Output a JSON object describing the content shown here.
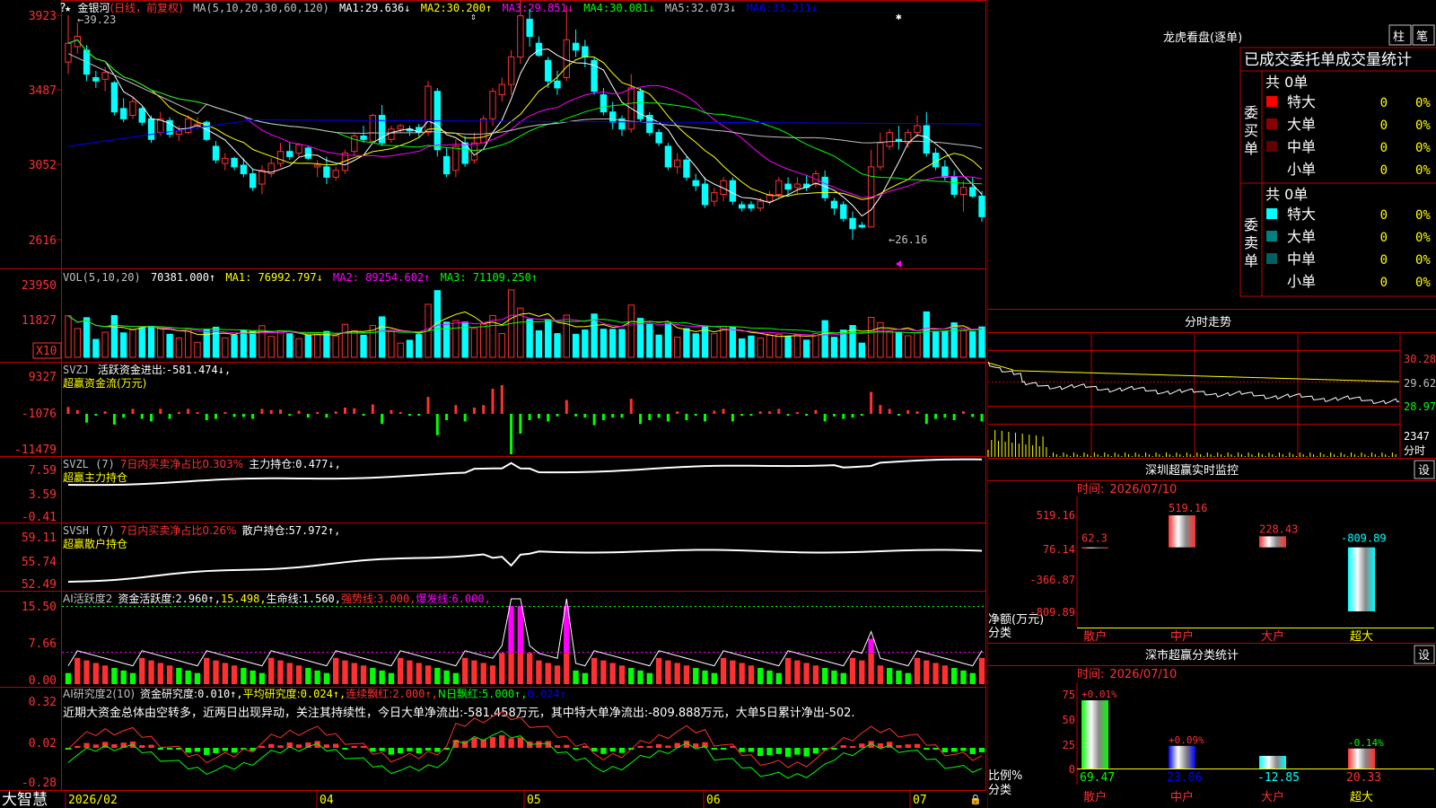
{
  "app": {
    "name": "大智慧"
  },
  "colors": {
    "up": "#ff3030",
    "down": "#00ffff",
    "frame": "#c00000",
    "bg": "#000000",
    "text": "#c0c0c0",
    "yellow": "#ffff00",
    "magenta": "#ff00ff",
    "green": "#00ff00"
  },
  "main": {
    "title": "金银河",
    "mode": "(日线，前复权)",
    "ma_label": "MA(5,10,20,30,60,120)",
    "ma_values": [
      {
        "label": "MA1:",
        "value": "29.636↓",
        "color": "#ffffff"
      },
      {
        "label": "MA2:",
        "value": "30.200↑",
        "color": "#ffff00"
      },
      {
        "label": "MA3:",
        "value": "29.851↓",
        "color": "#ff00ff"
      },
      {
        "label": "MA4:",
        "value": "30.081↓",
        "color": "#00ff00"
      },
      {
        "label": "MA5:",
        "value": "32.073↓",
        "color": "#c0c0c0"
      },
      {
        "label": "MA6:",
        "value": "33.211↓",
        "color": "#0000ff"
      }
    ],
    "high_label": "39.23",
    "low_label": "26.16",
    "y_ticks": [
      "3923",
      "3487",
      "3052",
      "2616"
    ]
  },
  "chart_data": [
    {
      "type": "candlestick",
      "title": "金银河(日线，前复权)",
      "x_ticks": [
        "2026/02",
        "04",
        "05",
        "06",
        "07"
      ],
      "y_ticks": [
        39.23,
        34.87,
        30.52,
        26.16
      ],
      "series_names": [
        "MA1",
        "MA2",
        "MA3",
        "MA4",
        "MA5",
        "MA6"
      ],
      "ohlc": [
        [
          36.5,
          39.23,
          35.8,
          37.6
        ],
        [
          37.4,
          38.8,
          37.0,
          38.0
        ],
        [
          37.2,
          37.5,
          35.4,
          35.8
        ],
        [
          35.6,
          36.0,
          35.0,
          35.4
        ],
        [
          35.5,
          36.2,
          34.8,
          35.9
        ],
        [
          35.3,
          35.4,
          33.4,
          33.6
        ],
        [
          33.8,
          34.4,
          33.0,
          33.2
        ],
        [
          33.4,
          34.5,
          33.2,
          34.2
        ],
        [
          33.8,
          33.9,
          32.8,
          33.0
        ],
        [
          33.2,
          33.4,
          31.8,
          32.0
        ],
        [
          32.4,
          33.6,
          32.2,
          33.2
        ],
        [
          33.1,
          33.3,
          32.1,
          32.3
        ],
        [
          32.3,
          32.8,
          31.9,
          32.5
        ],
        [
          32.4,
          33.4,
          32.3,
          33.2
        ],
        [
          32.8,
          33.3,
          32.6,
          32.9
        ],
        [
          33.0,
          33.1,
          31.9,
          32.0
        ],
        [
          31.6,
          31.9,
          30.6,
          30.8
        ],
        [
          30.6,
          31.2,
          30.2,
          30.9
        ],
        [
          30.9,
          31.0,
          30.2,
          30.4
        ],
        [
          30.5,
          30.9,
          29.8,
          30.0
        ],
        [
          30.0,
          30.3,
          29.0,
          29.2
        ],
        [
          29.4,
          30.5,
          28.8,
          30.2
        ],
        [
          30.0,
          30.9,
          29.8,
          30.6
        ],
        [
          30.6,
          31.8,
          30.4,
          31.3
        ],
        [
          31.3,
          31.8,
          30.8,
          31.0
        ],
        [
          31.2,
          31.8,
          31.0,
          31.7
        ],
        [
          31.5,
          31.6,
          30.8,
          30.9
        ],
        [
          30.4,
          30.8,
          29.8,
          30.5
        ],
        [
          30.4,
          31.0,
          29.4,
          29.8
        ],
        [
          29.8,
          30.4,
          29.6,
          30.2
        ],
        [
          30.2,
          31.4,
          30.0,
          31.2
        ],
        [
          31.3,
          32.4,
          31.1,
          32.2
        ],
        [
          32.2,
          32.8,
          31.8,
          32.0
        ],
        [
          31.9,
          33.5,
          31.8,
          33.4
        ],
        [
          33.4,
          34.0,
          31.6,
          31.8
        ],
        [
          32.0,
          32.8,
          31.8,
          32.6
        ],
        [
          32.6,
          32.9,
          32.4,
          32.8
        ],
        [
          32.6,
          32.8,
          32.2,
          32.5
        ],
        [
          32.7,
          32.9,
          32.1,
          32.4
        ],
        [
          32.4,
          35.4,
          32.2,
          35.1
        ],
        [
          34.8,
          35.0,
          31.0,
          31.4
        ],
        [
          31.0,
          31.5,
          29.8,
          30.0
        ],
        [
          30.2,
          32.0,
          29.8,
          31.6
        ],
        [
          31.8,
          32.2,
          30.4,
          30.6
        ],
        [
          30.8,
          32.4,
          30.6,
          31.8
        ],
        [
          31.8,
          33.4,
          31.8,
          33.2
        ],
        [
          33.2,
          35.0,
          32.8,
          34.8
        ],
        [
          34.6,
          35.6,
          34.2,
          35.2
        ],
        [
          35.2,
          37.2,
          34.6,
          36.8
        ],
        [
          36.8,
          40.1,
          36.4,
          39.2
        ],
        [
          39.0,
          39.6,
          37.4,
          38.0
        ],
        [
          37.6,
          38.0,
          36.8,
          36.9
        ],
        [
          36.6,
          36.8,
          35.0,
          35.4
        ],
        [
          35.4,
          36.0,
          34.6,
          35.0
        ],
        [
          35.6,
          39.8,
          35.4,
          37.8
        ],
        [
          37.6,
          38.4,
          36.8,
          37.2
        ],
        [
          37.4,
          37.8,
          36.2,
          36.8
        ],
        [
          36.6,
          36.8,
          34.6,
          34.8
        ],
        [
          34.6,
          35.0,
          33.4,
          33.6
        ],
        [
          33.6,
          34.2,
          32.6,
          33.0
        ],
        [
          33.2,
          33.4,
          32.2,
          32.6
        ],
        [
          32.6,
          35.8,
          32.4,
          35.0
        ],
        [
          34.8,
          35.0,
          33.0,
          33.2
        ],
        [
          33.4,
          33.6,
          32.2,
          32.4
        ],
        [
          32.4,
          32.6,
          31.6,
          31.8
        ],
        [
          31.6,
          31.8,
          30.2,
          30.4
        ],
        [
          30.4,
          31.2,
          30.0,
          30.8
        ],
        [
          30.8,
          31.0,
          29.6,
          29.8
        ],
        [
          29.6,
          30.0,
          29.0,
          29.3
        ],
        [
          29.4,
          29.8,
          28.0,
          28.2
        ],
        [
          28.4,
          29.2,
          28.1,
          28.9
        ],
        [
          28.8,
          29.8,
          28.4,
          29.6
        ],
        [
          29.6,
          29.8,
          28.2,
          28.4
        ],
        [
          28.2,
          28.4,
          27.8,
          28.0
        ],
        [
          28.2,
          28.4,
          27.8,
          28.0
        ],
        [
          28.0,
          28.6,
          27.8,
          28.4
        ],
        [
          28.4,
          29.0,
          28.2,
          28.8
        ],
        [
          28.8,
          29.8,
          28.6,
          29.6
        ],
        [
          29.4,
          29.8,
          28.8,
          29.1
        ],
        [
          29.2,
          29.8,
          28.8,
          29.4
        ],
        [
          29.4,
          29.9,
          29.0,
          29.2
        ],
        [
          29.4,
          30.2,
          29.2,
          30.0
        ],
        [
          29.8,
          30.2,
          28.4,
          28.6
        ],
        [
          28.4,
          28.6,
          27.6,
          28.0
        ],
        [
          28.2,
          28.4,
          27.2,
          27.4
        ],
        [
          27.4,
          27.8,
          26.16,
          26.8
        ],
        [
          27.0,
          27.2,
          26.8,
          26.9
        ],
        [
          26.9,
          31.4,
          26.9,
          30.4
        ],
        [
          30.4,
          32.4,
          30.2,
          31.8
        ],
        [
          31.6,
          32.6,
          31.4,
          32.4
        ],
        [
          32.0,
          32.8,
          31.4,
          31.9
        ],
        [
          31.8,
          32.6,
          31.5,
          32.4
        ],
        [
          32.4,
          33.4,
          32.1,
          32.8
        ],
        [
          32.8,
          33.6,
          31.0,
          31.2
        ],
        [
          31.2,
          31.5,
          30.2,
          30.4
        ],
        [
          30.4,
          30.8,
          29.6,
          29.8
        ],
        [
          29.8,
          30.2,
          28.6,
          28.8
        ],
        [
          28.8,
          29.6,
          27.8,
          29.2
        ],
        [
          29.2,
          29.8,
          28.6,
          28.7
        ],
        [
          28.7,
          29.0,
          27.2,
          27.5
        ]
      ]
    },
    {
      "type": "bar",
      "title": "VOL(5,10,20)",
      "y_ticks": [
        23950,
        11827
      ],
      "series": [
        {
          "name": "VOL",
          "value": "70381.000↑"
        },
        {
          "name": "MA1",
          "value": "76992.797↓"
        },
        {
          "name": "MA2",
          "value": "89254.602↑"
        },
        {
          "name": "MA3",
          "value": "71109.250↑"
        }
      ]
    },
    {
      "type": "bar",
      "title": "SVZJ 活跃资金进出",
      "subtitle": "超赢资金流(万元)",
      "y_ticks": [
        9327,
        -1076,
        -11479
      ],
      "latest": "-581.474↓"
    },
    {
      "type": "line",
      "title": "SVZL (7)",
      "subtitle": "超赢主力持仓",
      "y_ticks": [
        7.59,
        3.59,
        -0.41
      ],
      "ratio": "7日内买卖净占比0.303%",
      "holding": "0.477↓"
    },
    {
      "type": "line",
      "title": "SVSH (7)",
      "subtitle": "超赢散户持仓",
      "y_ticks": [
        59.11,
        55.74,
        52.49
      ],
      "ratio": "7日内买卖净占比0.26%",
      "holding": "57.972↑"
    },
    {
      "type": "bar",
      "title": "AI活跃度2",
      "y_ticks": [
        15.5,
        7.66,
        0.0
      ],
      "values": {
        "资金活跃度": "2.960↑",
        "v2": "15.498",
        "生命线": "1.560",
        "强势线": "3.000",
        "爆发线": "6.000"
      }
    },
    {
      "type": "bar",
      "title": "AI研究度2(10)",
      "y_ticks": [
        0.32,
        0.02,
        -0.28
      ],
      "values": {
        "资金研究度": "0.010↑",
        "平均研究度": "0.024↑",
        "连续飘红": "2.000↑",
        "N日飘红": "5.000↑",
        "v5": "0.024↑"
      }
    },
    {
      "type": "bar",
      "title": "深圳超赢实时监控",
      "categories": [
        "散户",
        "中户",
        "大户",
        "超大"
      ],
      "values": [
        62.3,
        519.16,
        228.43,
        -809.89
      ],
      "y_ticks": [
        519.16,
        76.14,
        -366.87,
        -809.89
      ],
      "date": "2026/07/10"
    },
    {
      "type": "bar",
      "title": "深市超赢分类统计",
      "categories": [
        "散户",
        "中户",
        "大户",
        "超大"
      ],
      "values": [
        69.47,
        23.06,
        -12.85,
        20.33
      ],
      "pct": [
        "+0.01%",
        "+0.09%",
        "",
        "-0.14%"
      ],
      "y_ticks": [
        75,
        50,
        25,
        0
      ],
      "date": "2026/07/10"
    }
  ],
  "indicators": {
    "vol": {
      "label": "VOL(5,10,20)",
      "value": "70381.000↑",
      "ma1": "76992.797↓",
      "ma2": "89254.602↑",
      "ma3": "71109.250↑",
      "unit": "X10",
      "y_ticks": [
        "23950",
        "11827"
      ]
    },
    "svzj": {
      "label": "SVZJ",
      "name": "活跃资金进出:",
      "value": "-581.474↓,",
      "subtitle": "超赢资金流(万元)",
      "y_ticks": [
        "9327",
        "-1076",
        "-11479"
      ]
    },
    "svzl": {
      "label": "SVZL (7)",
      "ratio": "7日内买卖净占比0.303%",
      "name": "主力持仓:",
      "value": "0.477↓,",
      "subtitle": "超赢主力持仓",
      "y_ticks": [
        "7.59",
        "3.59",
        "-0.41"
      ]
    },
    "svsh": {
      "label": "SVSH (7)",
      "ratio": "7日内买卖净占比0.26%",
      "name": "散户持仓:",
      "value": "57.972↑,",
      "subtitle": "超赢散户持仓",
      "y_ticks": [
        "59.11",
        "55.74",
        "52.49"
      ]
    },
    "ai_active": {
      "label": "AI活跃度2",
      "t1": "资金活跃度:",
      "v1": "2.960↑,",
      "v2": "15.498,",
      "t3": "生命线:",
      "v3": "1.560,",
      "t4": "强势线:",
      "v4": "3.000,",
      "t5": "爆发线:",
      "v5": "6.000,",
      "y_ticks": [
        "15.50",
        "7.66",
        "0.00"
      ]
    },
    "ai_research": {
      "label": "AI研究度2(10)",
      "t1": "资金研究度:",
      "v1": "0.010↑,",
      "t2": "平均研究度:",
      "v2": "0.024↑,",
      "t3": "连续飘红:",
      "v3": "2.000↑,",
      "t4": "N日飘红:",
      "v4": "5.000↑,",
      "v5": "0.024↑",
      "y_ticks": [
        "0.32",
        "0.02",
        "-0.28"
      ]
    },
    "comment": "近期大资金总体由空转多，近两日出现异动，关注其持续性，今日大单净流出:-581.458万元，其中特大单净流出:-809.888万元，大单5日累计净出-502."
  },
  "xaxis": {
    "labels": [
      "2026/02",
      "04",
      "05",
      "06",
      "07"
    ]
  },
  "right": {
    "longhu": {
      "title": "龙虎看盘(逐单)",
      "btn1": "柱",
      "btn2": "笔",
      "stat_title": "已成交委托单成交量统计",
      "buy": {
        "side": "委买单",
        "total": "共 0单",
        "rows": [
          {
            "name": "特大",
            "count": "0",
            "pct": "0%"
          },
          {
            "name": "大单",
            "count": "0",
            "pct": "0%"
          },
          {
            "name": "中单",
            "count": "0",
            "pct": "0%"
          },
          {
            "name": "小单",
            "count": "0",
            "pct": "0%"
          }
        ]
      },
      "sell": {
        "side": "委卖单",
        "total": "共 0单",
        "rows": [
          {
            "name": "特大",
            "count": "0",
            "pct": "0%"
          },
          {
            "name": "大单",
            "count": "0",
            "pct": "0%"
          },
          {
            "name": "中单",
            "count": "0",
            "pct": "0%"
          },
          {
            "name": "小单",
            "count": "0",
            "pct": "0%"
          }
        ]
      }
    },
    "intraday": {
      "title": "分时走势",
      "y": [
        "30.28",
        "29.62",
        "28.97"
      ],
      "vol": "2347",
      "vol_unit": "分时"
    },
    "monitor": {
      "title": "深圳超赢实时监控",
      "date_label": "时间:",
      "date": "2026/07/10",
      "set": "设",
      "y_unit1": "净额(万元)",
      "y_unit2": "分类",
      "y_ticks": [
        "519.16",
        "76.14",
        "-366.87",
        "-809.89"
      ],
      "bars": [
        {
          "name": "散户",
          "value": "62.3"
        },
        {
          "name": "中户",
          "value": "519.16"
        },
        {
          "name": "大户",
          "value": "228.43"
        },
        {
          "name": "超大",
          "value": "-809.89"
        }
      ]
    },
    "classify": {
      "title": "深市超赢分类统计",
      "date_label": "时间:",
      "date": "2026/07/10",
      "set": "设",
      "y_unit1": "比例%",
      "y_unit2": "分类",
      "y_ticks": [
        "75",
        "50",
        "25",
        "0"
      ],
      "bars": [
        {
          "name": "散户",
          "pct": "+0.01%",
          "value": "69.47"
        },
        {
          "name": "中户",
          "pct": "+0.09%",
          "value": "23.06"
        },
        {
          "name": "大户",
          "pct": "",
          "value": "-12.85"
        },
        {
          "name": "超大",
          "pct": "-0.14%",
          "value": "20.33"
        }
      ]
    }
  }
}
